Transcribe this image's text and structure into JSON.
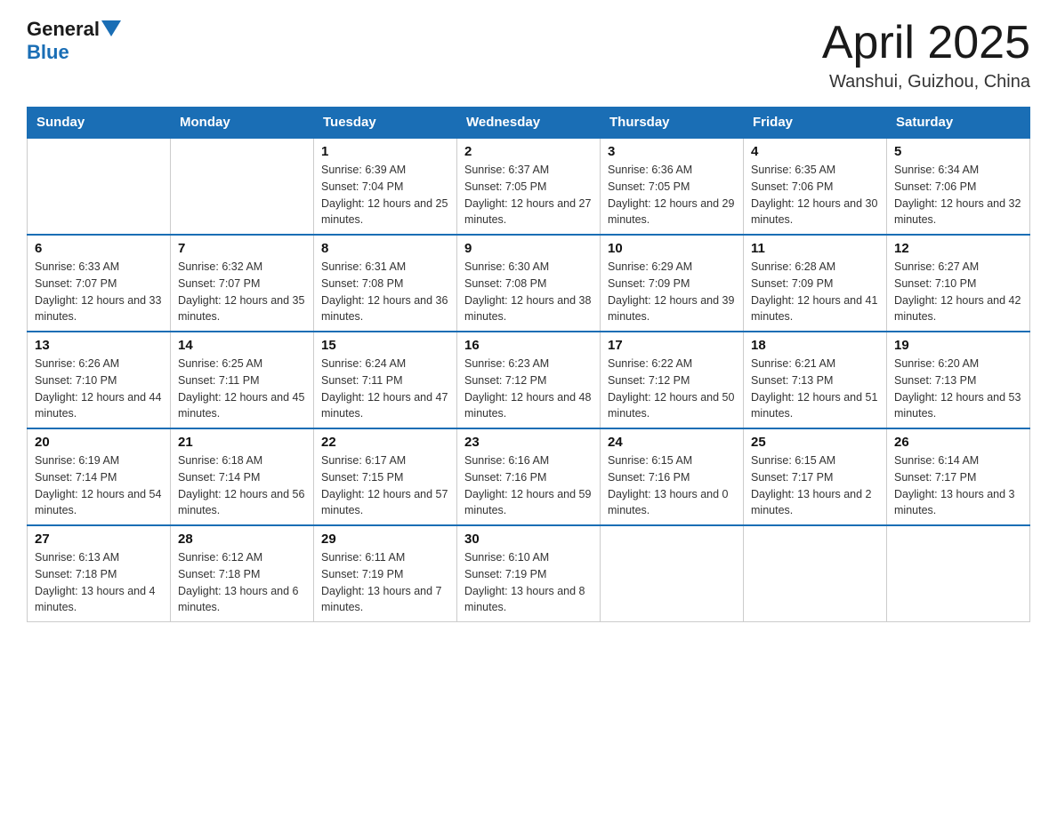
{
  "header": {
    "logo_general": "General",
    "logo_blue": "Blue",
    "title": "April 2025",
    "location": "Wanshui, Guizhou, China"
  },
  "calendar": {
    "days_of_week": [
      "Sunday",
      "Monday",
      "Tuesday",
      "Wednesday",
      "Thursday",
      "Friday",
      "Saturday"
    ],
    "weeks": [
      [
        {
          "day": "",
          "sunrise": "",
          "sunset": "",
          "daylight": ""
        },
        {
          "day": "",
          "sunrise": "",
          "sunset": "",
          "daylight": ""
        },
        {
          "day": "1",
          "sunrise": "Sunrise: 6:39 AM",
          "sunset": "Sunset: 7:04 PM",
          "daylight": "Daylight: 12 hours and 25 minutes."
        },
        {
          "day": "2",
          "sunrise": "Sunrise: 6:37 AM",
          "sunset": "Sunset: 7:05 PM",
          "daylight": "Daylight: 12 hours and 27 minutes."
        },
        {
          "day": "3",
          "sunrise": "Sunrise: 6:36 AM",
          "sunset": "Sunset: 7:05 PM",
          "daylight": "Daylight: 12 hours and 29 minutes."
        },
        {
          "day": "4",
          "sunrise": "Sunrise: 6:35 AM",
          "sunset": "Sunset: 7:06 PM",
          "daylight": "Daylight: 12 hours and 30 minutes."
        },
        {
          "day": "5",
          "sunrise": "Sunrise: 6:34 AM",
          "sunset": "Sunset: 7:06 PM",
          "daylight": "Daylight: 12 hours and 32 minutes."
        }
      ],
      [
        {
          "day": "6",
          "sunrise": "Sunrise: 6:33 AM",
          "sunset": "Sunset: 7:07 PM",
          "daylight": "Daylight: 12 hours and 33 minutes."
        },
        {
          "day": "7",
          "sunrise": "Sunrise: 6:32 AM",
          "sunset": "Sunset: 7:07 PM",
          "daylight": "Daylight: 12 hours and 35 minutes."
        },
        {
          "day": "8",
          "sunrise": "Sunrise: 6:31 AM",
          "sunset": "Sunset: 7:08 PM",
          "daylight": "Daylight: 12 hours and 36 minutes."
        },
        {
          "day": "9",
          "sunrise": "Sunrise: 6:30 AM",
          "sunset": "Sunset: 7:08 PM",
          "daylight": "Daylight: 12 hours and 38 minutes."
        },
        {
          "day": "10",
          "sunrise": "Sunrise: 6:29 AM",
          "sunset": "Sunset: 7:09 PM",
          "daylight": "Daylight: 12 hours and 39 minutes."
        },
        {
          "day": "11",
          "sunrise": "Sunrise: 6:28 AM",
          "sunset": "Sunset: 7:09 PM",
          "daylight": "Daylight: 12 hours and 41 minutes."
        },
        {
          "day": "12",
          "sunrise": "Sunrise: 6:27 AM",
          "sunset": "Sunset: 7:10 PM",
          "daylight": "Daylight: 12 hours and 42 minutes."
        }
      ],
      [
        {
          "day": "13",
          "sunrise": "Sunrise: 6:26 AM",
          "sunset": "Sunset: 7:10 PM",
          "daylight": "Daylight: 12 hours and 44 minutes."
        },
        {
          "day": "14",
          "sunrise": "Sunrise: 6:25 AM",
          "sunset": "Sunset: 7:11 PM",
          "daylight": "Daylight: 12 hours and 45 minutes."
        },
        {
          "day": "15",
          "sunrise": "Sunrise: 6:24 AM",
          "sunset": "Sunset: 7:11 PM",
          "daylight": "Daylight: 12 hours and 47 minutes."
        },
        {
          "day": "16",
          "sunrise": "Sunrise: 6:23 AM",
          "sunset": "Sunset: 7:12 PM",
          "daylight": "Daylight: 12 hours and 48 minutes."
        },
        {
          "day": "17",
          "sunrise": "Sunrise: 6:22 AM",
          "sunset": "Sunset: 7:12 PM",
          "daylight": "Daylight: 12 hours and 50 minutes."
        },
        {
          "day": "18",
          "sunrise": "Sunrise: 6:21 AM",
          "sunset": "Sunset: 7:13 PM",
          "daylight": "Daylight: 12 hours and 51 minutes."
        },
        {
          "day": "19",
          "sunrise": "Sunrise: 6:20 AM",
          "sunset": "Sunset: 7:13 PM",
          "daylight": "Daylight: 12 hours and 53 minutes."
        }
      ],
      [
        {
          "day": "20",
          "sunrise": "Sunrise: 6:19 AM",
          "sunset": "Sunset: 7:14 PM",
          "daylight": "Daylight: 12 hours and 54 minutes."
        },
        {
          "day": "21",
          "sunrise": "Sunrise: 6:18 AM",
          "sunset": "Sunset: 7:14 PM",
          "daylight": "Daylight: 12 hours and 56 minutes."
        },
        {
          "day": "22",
          "sunrise": "Sunrise: 6:17 AM",
          "sunset": "Sunset: 7:15 PM",
          "daylight": "Daylight: 12 hours and 57 minutes."
        },
        {
          "day": "23",
          "sunrise": "Sunrise: 6:16 AM",
          "sunset": "Sunset: 7:16 PM",
          "daylight": "Daylight: 12 hours and 59 minutes."
        },
        {
          "day": "24",
          "sunrise": "Sunrise: 6:15 AM",
          "sunset": "Sunset: 7:16 PM",
          "daylight": "Daylight: 13 hours and 0 minutes."
        },
        {
          "day": "25",
          "sunrise": "Sunrise: 6:15 AM",
          "sunset": "Sunset: 7:17 PM",
          "daylight": "Daylight: 13 hours and 2 minutes."
        },
        {
          "day": "26",
          "sunrise": "Sunrise: 6:14 AM",
          "sunset": "Sunset: 7:17 PM",
          "daylight": "Daylight: 13 hours and 3 minutes."
        }
      ],
      [
        {
          "day": "27",
          "sunrise": "Sunrise: 6:13 AM",
          "sunset": "Sunset: 7:18 PM",
          "daylight": "Daylight: 13 hours and 4 minutes."
        },
        {
          "day": "28",
          "sunrise": "Sunrise: 6:12 AM",
          "sunset": "Sunset: 7:18 PM",
          "daylight": "Daylight: 13 hours and 6 minutes."
        },
        {
          "day": "29",
          "sunrise": "Sunrise: 6:11 AM",
          "sunset": "Sunset: 7:19 PM",
          "daylight": "Daylight: 13 hours and 7 minutes."
        },
        {
          "day": "30",
          "sunrise": "Sunrise: 6:10 AM",
          "sunset": "Sunset: 7:19 PM",
          "daylight": "Daylight: 13 hours and 8 minutes."
        },
        {
          "day": "",
          "sunrise": "",
          "sunset": "",
          "daylight": ""
        },
        {
          "day": "",
          "sunrise": "",
          "sunset": "",
          "daylight": ""
        },
        {
          "day": "",
          "sunrise": "",
          "sunset": "",
          "daylight": ""
        }
      ]
    ]
  }
}
